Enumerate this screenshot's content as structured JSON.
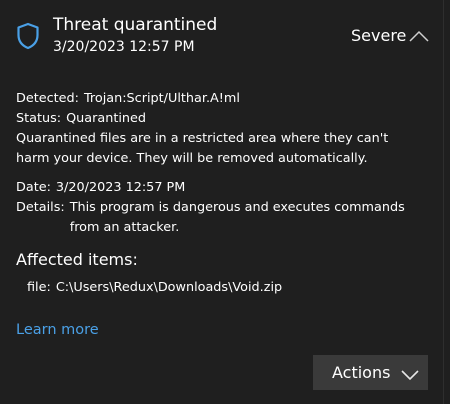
{
  "header": {
    "title": "Threat quarantined",
    "time": "3/20/2023 12:57 PM",
    "severity": "Severe",
    "icon": "shield-icon",
    "collapse_icon": "chevron-up-icon"
  },
  "details": {
    "detected_label": "Detected:",
    "detected_value": "Trojan:Script/Ulthar.A!ml",
    "status_label": "Status:",
    "status_value": "Quarantined",
    "description": "Quarantined files are in a restricted area where they can't harm your device. They will be removed automatically.",
    "date_label": "Date:",
    "date_value": "3/20/2023 12:57 PM",
    "details_label": "Details:",
    "details_value": "This program is dangerous and executes commands from an attacker."
  },
  "affected": {
    "heading": "Affected items:",
    "items": [
      {
        "label": "file:",
        "path": "C:\\Users\\Redux\\Downloads\\Void.zip"
      }
    ]
  },
  "links": {
    "learn_more": "Learn more"
  },
  "actions": {
    "label": "Actions",
    "icon": "chevron-down-icon"
  },
  "colors": {
    "background": "#1f1f1f",
    "text": "#ffffff",
    "link": "#4aa0e6",
    "shield": "#4aa0e6",
    "button": "#3a3a3a"
  }
}
